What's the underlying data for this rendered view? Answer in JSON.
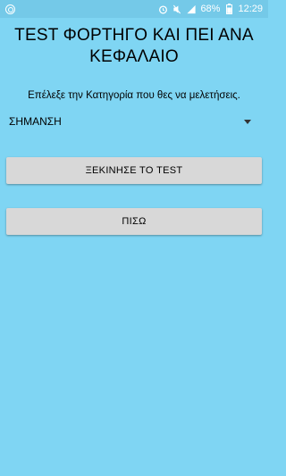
{
  "status_bar": {
    "battery": "68%",
    "time": "12:29",
    "icons": [
      "notification-icon",
      "alarm-icon",
      "mute-icon",
      "signal-icon",
      "battery-icon"
    ]
  },
  "title": "TEST ΦΟΡΤΗΓΟ ΚΑΙ ΠΕΙ ΑΝΑ ΚΕΦΑΛΑΙΟ",
  "prompt": "Επέλεξε την Κατηγορία που θες να μελετήσεις.",
  "category_select": {
    "selected": "ΣΗΜΑΝΣΗ"
  },
  "buttons": {
    "start_test": "ΞΕΚΙΝΗΣΕ ΤΟ TEST",
    "back": "ΠΙΣΩ"
  },
  "colors": {
    "background": "#7fd5f3",
    "status_bar": "#74c9e8",
    "button": "#d8d8d8"
  }
}
